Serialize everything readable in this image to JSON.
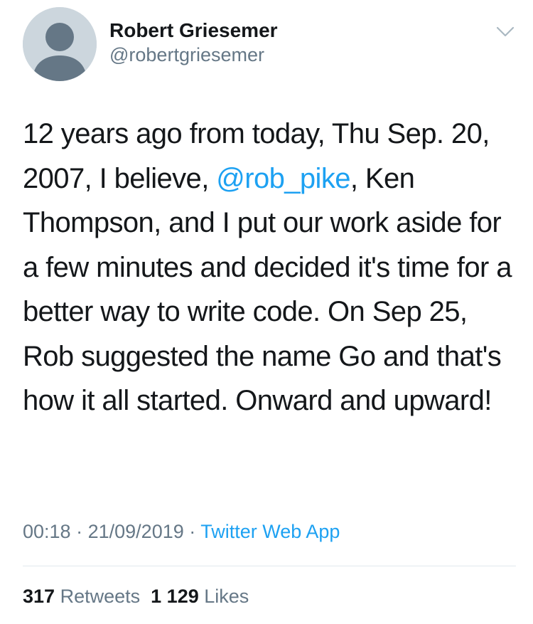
{
  "author": {
    "display_name": "Robert Griesemer",
    "handle": "@robertgriesemer",
    "avatar_icon": "default-profile-icon"
  },
  "menu_icon": "chevron-down-icon",
  "tweet": {
    "text_before_mention": "12 years ago from today, Thu Sep. 20, 2007, I believe, ",
    "mention": "@rob_pike",
    "text_after_mention": ", Ken Thompson, and I put our work aside for a few minutes and decided it's time for a better way to write code. On Sep 25, Rob suggested the name Go and that's how it all started. Onward and upward!"
  },
  "meta": {
    "time": "00:18",
    "separator": "·",
    "date": "21/09/2019",
    "source": "Twitter Web App"
  },
  "stats": {
    "retweets_count": "317",
    "retweets_label": "Retweets",
    "likes_count": "1 129",
    "likes_label": "Likes"
  },
  "colors": {
    "accent": "#1da1f2",
    "secondary_text": "#657786",
    "primary_text": "#14171a",
    "avatar_bg": "#ccd6dd",
    "divider": "#e1e8ed"
  }
}
